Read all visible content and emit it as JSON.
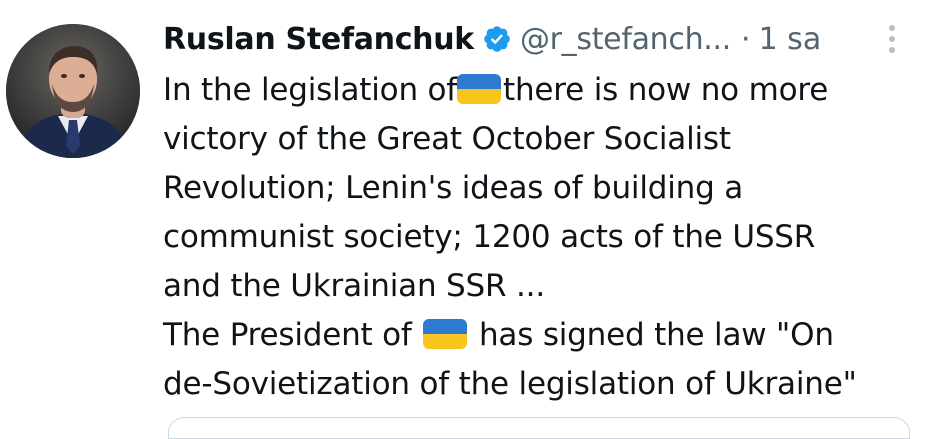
{
  "tweet": {
    "author": {
      "display_name": "Ruslan Stefanchuk",
      "handle": "@r_stefanch...",
      "verified": true,
      "avatar_icon": "profile-photo"
    },
    "separator": "·",
    "time": "1 sa",
    "more_icon": "vertical-ellipsis-icon",
    "body": {
      "line1_before_flag": "In the legislation of",
      "line1_after_flag": "there is now no more",
      "line2": "victory of the Great October Socialist",
      "line3": "Revolution; Lenin's ideas of building a",
      "line4": "communist society; 1200 acts of the USSR",
      "line5": "and the Ukrainian SSR ...",
      "line6_before_flag": "The President of",
      "line6_after_flag": "has signed the law \"On",
      "line7": "de-Sovietization of the legislation of Ukraine\""
    },
    "flag_emoji": {
      "name": "ukraine-flag-icon",
      "colors": [
        "#2e7ad1",
        "#f7c51c"
      ]
    },
    "colors": {
      "text": "#0f1419",
      "secondary": "#536471",
      "verified_badge": "#1d9bf0"
    }
  }
}
